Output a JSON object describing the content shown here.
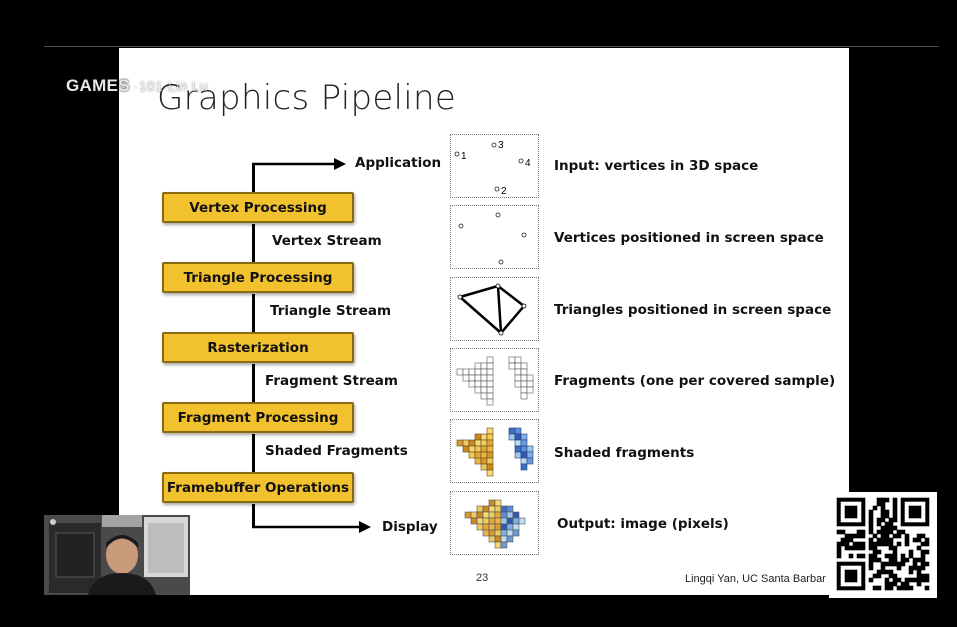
{
  "watermark": {
    "brand": "GAMES",
    "overlay": "·101·Lin Lu"
  },
  "slide": {
    "title": "Graphics Pipeline",
    "page_number": "23",
    "credit": "Lingqi Yan, UC Santa Barbar"
  },
  "pipeline": {
    "application": "Application",
    "display": "Display",
    "stages": [
      "Vertex Processing",
      "Triangle Processing",
      "Rasterization",
      "Fragment Processing",
      "Framebuffer Operations"
    ],
    "streams": [
      "Vertex Stream",
      "Triangle Stream",
      "Fragment Stream",
      "Shaded Fragments"
    ]
  },
  "illustrations": {
    "vertex_numbers": [
      "1",
      "2",
      "3",
      "4"
    ],
    "descriptions": [
      "Input: vertices in 3D space",
      "Vertices positioned in screen space",
      "Triangles positioned in screen space",
      "Fragments (one per covered sample)",
      "Shaded fragments",
      "Output: image (pixels)"
    ]
  },
  "colors": {
    "stage_fill": "#f2c12e",
    "stage_border": "#8a6a10",
    "background": "#000000",
    "slide": "#ffffff"
  }
}
